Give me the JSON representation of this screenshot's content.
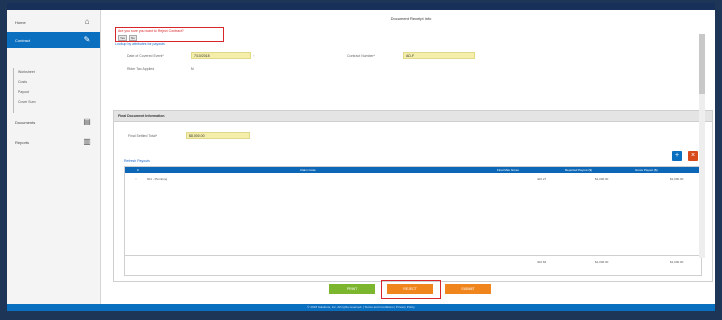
{
  "app": {
    "title": "Document Receipt Info"
  },
  "sidebar": {
    "items": [
      {
        "label": "Home",
        "icon": "home-icon"
      },
      {
        "label": "Contract",
        "icon": "pencil-icon"
      },
      {
        "label": "Documents",
        "icon": "document-icon"
      },
      {
        "label": "Reports",
        "icon": "bar-chart-icon"
      }
    ],
    "subitems": [
      "Worksheet",
      "Costs",
      "Payout",
      "Cover Sum"
    ]
  },
  "warning": {
    "text": "Are you sure you want to Reject Contract?",
    "yes_label": "Yes",
    "no_label": "No"
  },
  "links": {
    "lookup": "Lookup by attributes for payouts",
    "refresh": "Refresh Payouts"
  },
  "fields": {
    "date_label": "Date of Covered Event*",
    "date_value": "7/10/2018",
    "contract_label": "Contract Number*",
    "contract_value": "AD-F",
    "tax_label": "Rider Tax Applied",
    "tax_value": "N",
    "final_label": "Final Settled Total*",
    "final_value": "$8,000.00"
  },
  "section": {
    "title": "Final Document Information"
  },
  "table": {
    "headers": [
      "#",
      "Claim Code",
      "Final Max Gross",
      "Reported Payout ($)",
      "Gross Payout ($)"
    ],
    "rows": [
      {
        "num": "1",
        "code": "601 - Plumbing",
        "max": "402.27",
        "reported": "$1,000.00",
        "gross": "$1,000.00"
      }
    ],
    "totals": {
      "max": "402.84",
      "reported": "$1,000.00",
      "gross": "$1,000.00"
    }
  },
  "buttons": {
    "save": "PRINT",
    "reject": "REJECT",
    "submit": "SUBMIT"
  },
  "footer": {
    "text": "© 2018 Solutions, Inc. All rights reserved. | Terms and Conditions | Privacy Policy"
  },
  "colors": {
    "primary": "#0b6fbf",
    "save": "#7cb62e",
    "reject": "#f0841d",
    "warning": "#d8262b",
    "field": "#f4eeaa"
  }
}
